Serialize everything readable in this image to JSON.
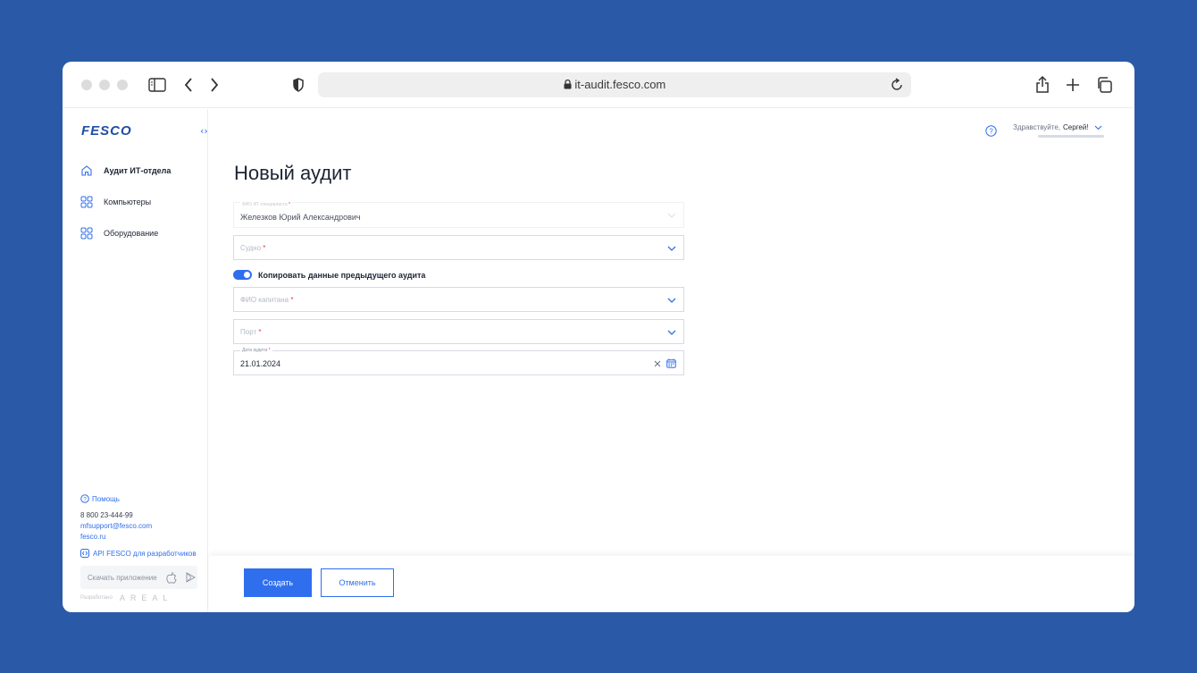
{
  "browser": {
    "url": "it-audit.fesco.com"
  },
  "sidebar": {
    "logo_text": "FESCO",
    "items": [
      {
        "label": "Аудит ИТ-отдела",
        "icon": "home-icon",
        "active": true
      },
      {
        "label": "Компьютеры",
        "icon": "grid-icon",
        "active": false
      },
      {
        "label": "Оборудование",
        "icon": "grid-icon",
        "active": false
      }
    ],
    "help_label": "Помощь",
    "phone": "8 800 23-444-99",
    "email": "mfsupport@fesco.com",
    "site": "fesco.ru",
    "api_label": "API FESCO для разработчиков",
    "download_app": "Скачать приложение",
    "developed_by": "Разработано",
    "developer": "AREAL"
  },
  "header": {
    "greeting": "Здравствуйте,",
    "user_name": "Сергей!"
  },
  "form": {
    "title": "Новый аудит",
    "specialist": {
      "label": "ФИО ИТ-специалиста",
      "value": "Железков Юрий Александрович"
    },
    "vessel": {
      "placeholder": "Судно"
    },
    "copy_toggle": {
      "label": "Копировать данные предыдущего аудита",
      "on": true
    },
    "captain": {
      "placeholder": "ФИО капитана"
    },
    "port": {
      "placeholder": "Порт"
    },
    "audit_date": {
      "label": "Дата аудита",
      "value": "21.01.2024"
    },
    "required_mark": "*"
  },
  "footer": {
    "create_label": "Создать",
    "cancel_label": "Отменить"
  },
  "colors": {
    "accent": "#2f6fed",
    "background": "#2a5aa7",
    "required": "#e0443b"
  }
}
